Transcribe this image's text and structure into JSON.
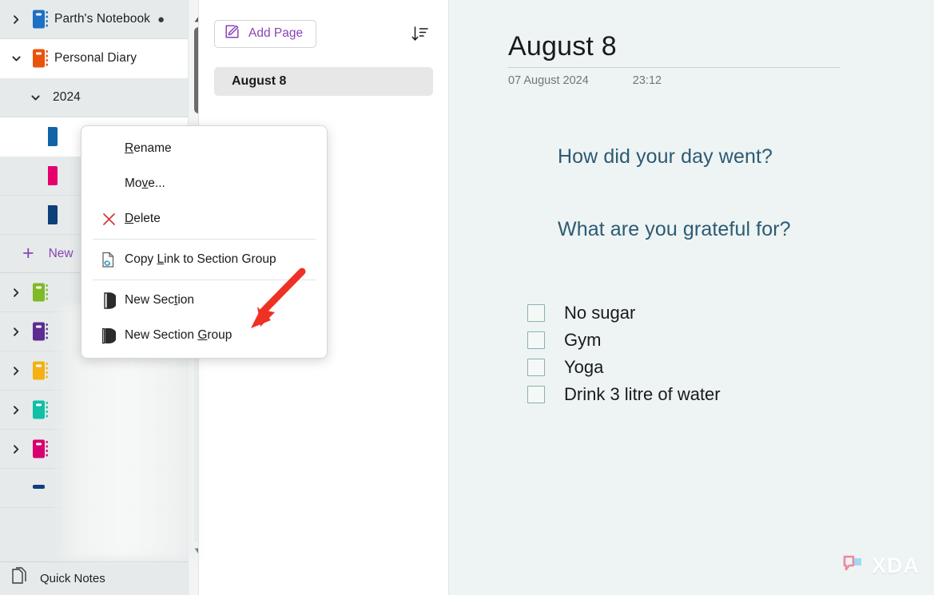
{
  "sidebar": {
    "notebooks": [
      {
        "label": "Parth's Notebook",
        "icon": "notebook-icon",
        "color": "#1f6fc4",
        "chevron": "chevron-right-icon",
        "expanded": false,
        "selected": false,
        "badge": "●"
      },
      {
        "label": "Personal Diary",
        "icon": "notebook-icon",
        "color": "#e8540c",
        "chevron": "chevron-down-icon",
        "expanded": true,
        "selected": true,
        "badge": ""
      }
    ],
    "group": {
      "label": "2024",
      "chevron": "chevron-down-icon",
      "expanded": true
    },
    "sections": [
      {
        "label": "",
        "color": "#1163a8",
        "selected": true
      },
      {
        "label": "",
        "color": "#e5006d",
        "selected": false
      },
      {
        "label": "",
        "color": "#0d3f79",
        "selected": false
      }
    ],
    "new_section": {
      "plus": "+",
      "label": "New"
    },
    "more_notebooks": [
      {
        "color": "#7fba27",
        "chevron": "chevron-right-icon"
      },
      {
        "color": "#5c2d91",
        "chevron": "chevron-right-icon"
      },
      {
        "color": "#f5b111",
        "chevron": "chevron-right-icon"
      },
      {
        "color": "#0fbfa6",
        "chevron": "chevron-right-icon"
      },
      {
        "color": "#d6006e",
        "chevron": "chevron-right-icon"
      }
    ],
    "quick_notes": {
      "label": "Quick Notes",
      "icon": "pages-icon"
    },
    "scrollbar": {
      "up": "scroll-up-arrow",
      "down": "scroll-down-arrow"
    }
  },
  "pagelist": {
    "add_page": {
      "label": "Add Page",
      "icon": "new-page-icon",
      "color": "#8a43b8"
    },
    "sort": {
      "icon": "sort-descending-icon"
    },
    "pages": [
      {
        "label": "August 8",
        "selected": true
      }
    ]
  },
  "canvas": {
    "title": "August 8",
    "date": "07 August 2024",
    "time": "23:12",
    "headings": [
      "How did your day went?",
      "What are you grateful for?"
    ],
    "heading_color": "#2d5a74",
    "checklist": [
      {
        "label": "No sugar",
        "checked": false
      },
      {
        "label": "Gym",
        "checked": false
      },
      {
        "label": "Yoga",
        "checked": false
      },
      {
        "label": "Drink 3 litre of water",
        "checked": false
      }
    ]
  },
  "context_menu": {
    "items": [
      {
        "label": "Rename",
        "accel": "R",
        "icon": null,
        "sep_after": false
      },
      {
        "label": "Move...",
        "accel": "v",
        "icon": null,
        "sep_after": false
      },
      {
        "label": "Delete",
        "accel": "D",
        "icon": "close-icon",
        "sep_after": true
      },
      {
        "label": "Copy Link to Section Group",
        "accel": "L",
        "icon": "copy-link-icon",
        "sep_after": true
      },
      {
        "label": "New Section",
        "accel": "t",
        "icon": "new-section-icon",
        "sep_after": false
      },
      {
        "label": "New Section Group",
        "accel": "G",
        "icon": "new-section-group-icon",
        "sep_after": false
      }
    ]
  },
  "annotation": {
    "arrow_color": "#ee3124"
  },
  "watermark": {
    "text": "XDA"
  }
}
